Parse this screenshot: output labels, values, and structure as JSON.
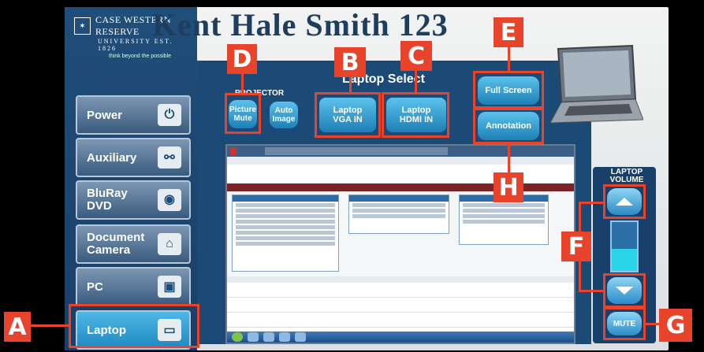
{
  "logo": {
    "name_line1": "CASE WESTERN RESERVE",
    "name_line2": "UNIVERSITY EST. 1826",
    "tagline": "think beyond the possible"
  },
  "page_title": "Kent Hale Smith 123",
  "sources": [
    {
      "label": "Power",
      "icon": "power-icon"
    },
    {
      "label": "Auxiliary",
      "icon": "cable-icon"
    },
    {
      "label": "BluRay\nDVD",
      "icon": "bluray-disc-icon"
    },
    {
      "label": "Document\nCamera",
      "icon": "document-camera-icon"
    },
    {
      "label": "PC",
      "icon": "desktop-computer-icon"
    },
    {
      "label": "Laptop",
      "icon": "laptop-icon",
      "active": true
    }
  ],
  "projector": {
    "label": "PROJECTOR",
    "picture_mute": "Picture\nMute",
    "auto_image": "Auto\nImage"
  },
  "laptop_select": {
    "title": "Laptop Select",
    "vga": "Laptop\nVGA IN",
    "hdmi": "Laptop\nHDMI IN"
  },
  "right_buttons": {
    "full_screen": "Full Screen",
    "annotation": "Annotation"
  },
  "volume": {
    "label": "LAPTOP\nVOLUME",
    "mute": "MUTE",
    "level": 0.45
  },
  "annotations": [
    "A",
    "B",
    "C",
    "D",
    "E",
    "F",
    "G",
    "H"
  ],
  "colors": {
    "highlight": "#e8432b",
    "panel_blue": "#1c4a76",
    "button_cyan": "#5cc2ec"
  }
}
